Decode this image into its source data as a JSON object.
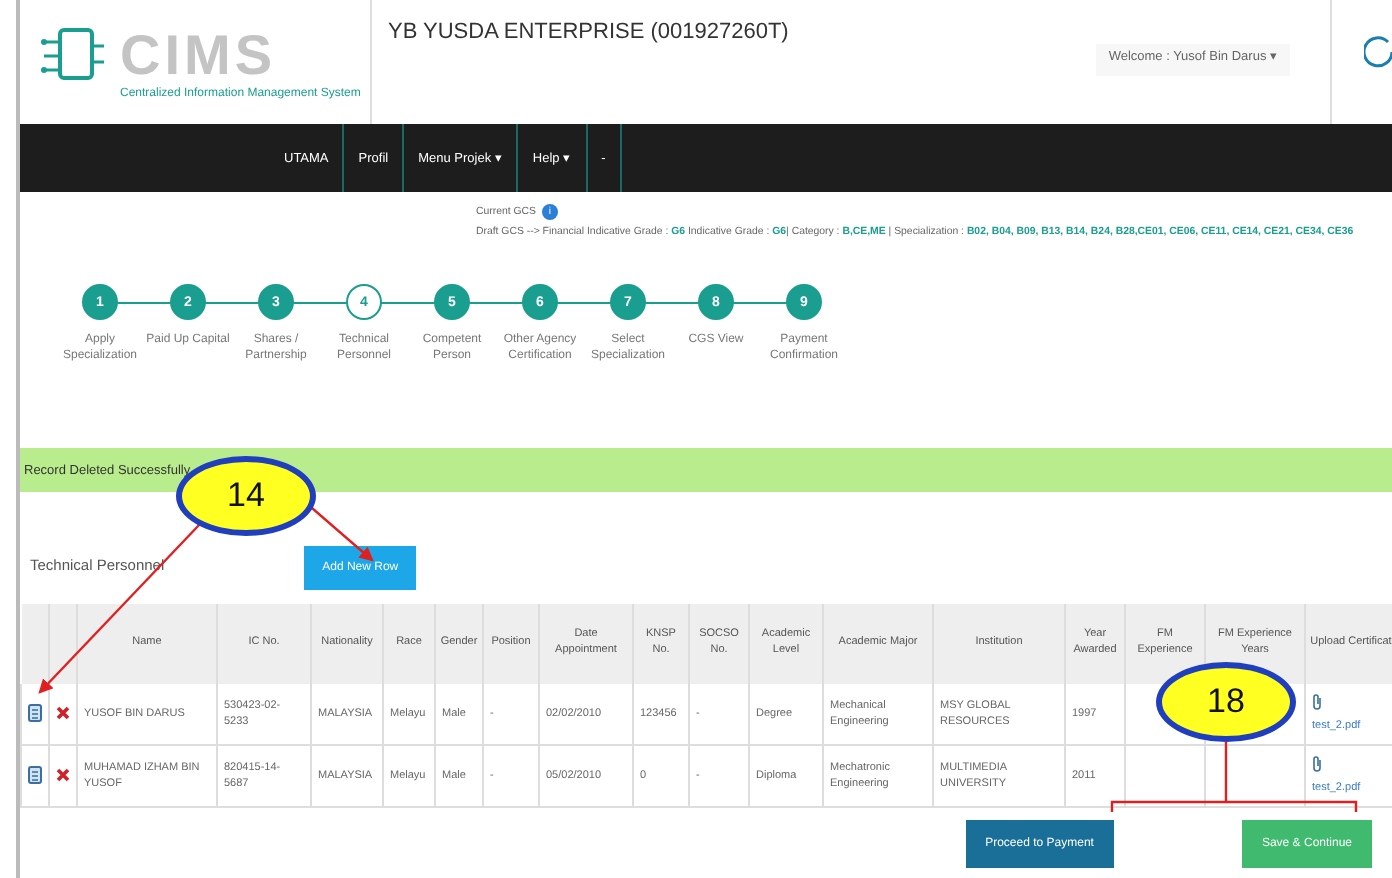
{
  "header": {
    "logo_text": "CIMS",
    "logo_subtitle": "Centralized Information Management System",
    "company": "YB YUSDA ENTERPRISE (001927260T)",
    "welcome": "Welcome : Yusof Bin Darus ▾"
  },
  "nav": [
    "UTAMA",
    "Profil",
    "Menu Projek ▾",
    "Help ▾",
    "-"
  ],
  "gcs": {
    "current_label": "Current GCS",
    "badge": "i",
    "draft_prefix": "Draft GCS --> Financial Indicative Grade :",
    "financial_grade": "G6",
    "indicative_label": "Indicative Grade :",
    "indicative_grade": "G6",
    "category_label": "| Category :",
    "category": "B,CE,ME",
    "specialization_label": "| Specialization :",
    "specialization": "B02, B04, B09, B13, B14, B24, B28,CE01, CE06, CE11, CE14, CE21, CE34, CE36"
  },
  "steps": [
    {
      "number": "1",
      "label": "Apply Specialization",
      "current": false
    },
    {
      "number": "2",
      "label": "Paid Up Capital",
      "current": false
    },
    {
      "number": "3",
      "label": "Shares / Partnership",
      "current": false
    },
    {
      "number": "4",
      "label": "Technical Personnel",
      "current": true
    },
    {
      "number": "5",
      "label": "Competent Person",
      "current": false
    },
    {
      "number": "6",
      "label": "Other Agency Certification",
      "current": false
    },
    {
      "number": "7",
      "label": "Select Specialization",
      "current": false
    },
    {
      "number": "8",
      "label": "CGS View",
      "current": false
    },
    {
      "number": "9",
      "label": "Payment Confirmation",
      "current": false
    }
  ],
  "alert": "Record Deleted Successfully",
  "section_title": "Technical Personnel",
  "add_button": "Add New Row",
  "table": {
    "columns": [
      "Name",
      "IC No.",
      "Nationality",
      "Race",
      "Gender",
      "Position",
      "Date Appointment",
      "KNSP No.",
      "SOCSO No.",
      "Academic Level",
      "Academic Major",
      "Institution",
      "Year Awarded",
      "FM Experience",
      "FM Experience Years",
      "Upload Certificat"
    ],
    "rows": [
      {
        "cells": [
          "YUSOF BIN DARUS",
          "530423-02-5233",
          "MALAYSIA",
          "Melayu",
          "Male",
          "-",
          "02/02/2010",
          "123456",
          "-",
          "Degree",
          "Mechanical Engineering",
          "MSY GLOBAL RESOURCES",
          "1997",
          "",
          ""
        ],
        "file": "test_2.pdf"
      },
      {
        "cells": [
          "MUHAMAD IZHAM BIN YUSOF",
          "820415-14-5687",
          "MALAYSIA",
          "Melayu",
          "Male",
          "-",
          "05/02/2010",
          "0",
          "-",
          "Diploma",
          "Mechatronic Engineering",
          "MULTIMEDIA UNIVERSITY",
          "2011",
          "",
          ""
        ],
        "file": "test_2.pdf"
      }
    ]
  },
  "buttons": [
    {
      "label": "Proceed to Payment",
      "kind": "primary"
    },
    {
      "label": "Save & Continue",
      "kind": "success"
    }
  ],
  "callouts": [
    "14",
    "18"
  ]
}
